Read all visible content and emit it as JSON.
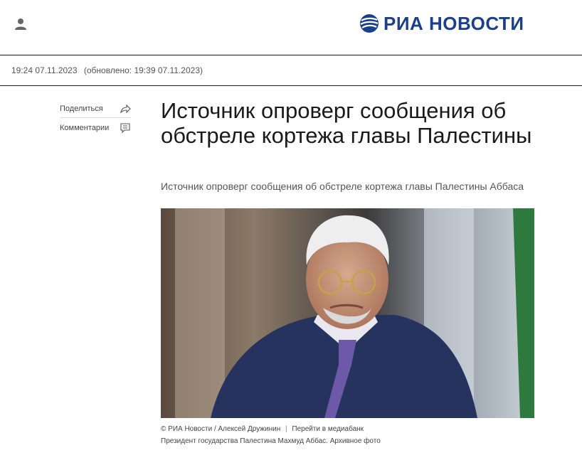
{
  "header": {
    "logo_text": "РИА НОВОСТИ",
    "user_icon": "user-icon",
    "brand_color": "#1b3f8b"
  },
  "meta": {
    "published": "19:24 07.11.2023",
    "updated": "(обновлено: 19:39 07.11.2023)"
  },
  "actions": {
    "share_label": "Поделиться",
    "share_icon": "share-icon",
    "comments_label": "Комментарии",
    "comments_icon": "comment-icon"
  },
  "article": {
    "title": "Источник опроверг сообщения об обстреле кортежа главы Палестины",
    "subtitle": "Источник опроверг сообщения об обстреле кортежа главы Палестины Аббаса"
  },
  "photo": {
    "credit": "© РИА Новости / Алексей Дружинин",
    "separator": "|",
    "mediabank_link": "Перейти в медиабанк",
    "caption": "Президент государства Палестина Махмуд Аббас. Архивное фото"
  }
}
